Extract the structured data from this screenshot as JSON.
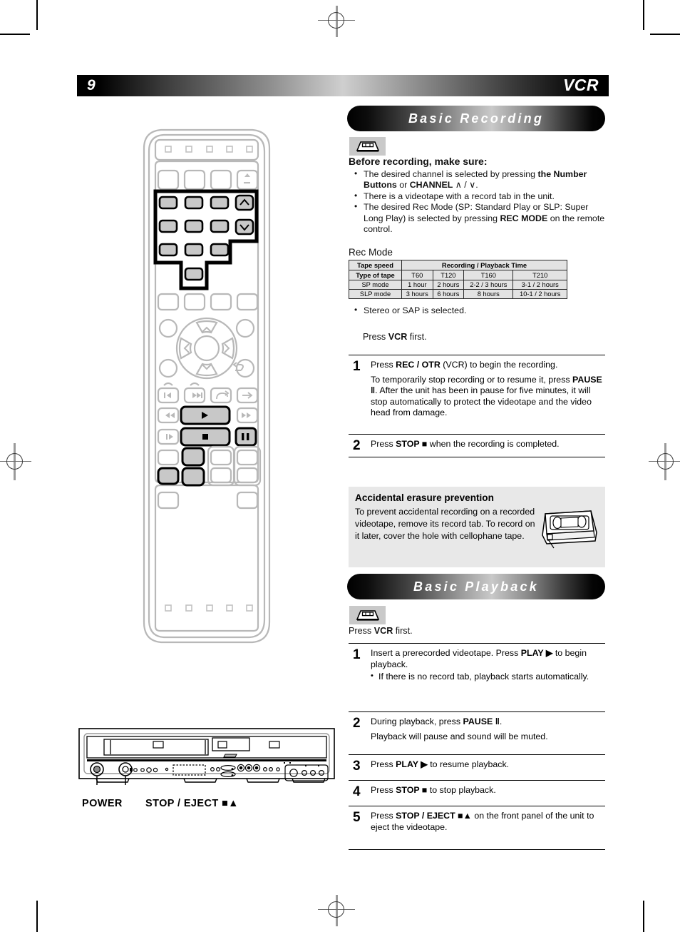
{
  "page": {
    "number": "9",
    "title": "VCR"
  },
  "sections": {
    "recording": {
      "banner": "Basic Recording",
      "tape_icon": "vhs-cassette-icon"
    },
    "playback": {
      "banner": "Basic Playback",
      "tape_icon": "vhs-cassette-icon"
    }
  },
  "before": {
    "heading": "Before recording, make sure:",
    "items": [
      {
        "parts": [
          {
            "t": "The desired channel is selected by pressing ",
            "b": false
          },
          {
            "t": "the Number Buttons",
            "b": true
          },
          {
            "t": " or ",
            "b": false
          },
          {
            "t": "CHANNEL",
            "b": true
          },
          {
            "t": " ∧ / ∨.",
            "b": false
          }
        ]
      },
      {
        "parts": [
          {
            "t": "There is a videotape with a record tab in the unit.",
            "b": false
          }
        ]
      },
      {
        "parts": [
          {
            "t": "The desired Rec Mode (SP: Standard Play or SLP: Super Long Play) is selected by pressing ",
            "b": false
          },
          {
            "t": "REC MODE",
            "b": true
          },
          {
            "t": " on the remote control.",
            "b": false
          }
        ]
      }
    ]
  },
  "rec_mode": {
    "label": "Rec Mode",
    "table": {
      "header_left": "Tape speed",
      "header_span": "Recording / Playback Time",
      "row_type_label": "Type of tape",
      "tape_types": [
        "T60",
        "T120",
        "T160",
        "T210"
      ],
      "rows": [
        {
          "mode": "SP mode",
          "values": [
            "1 hour",
            "2 hours",
            "2-2 / 3 hours",
            "3-1 / 2 hours"
          ]
        },
        {
          "mode": "SLP mode",
          "values": [
            "3 hours",
            "6 hours",
            "8 hours",
            "10-1 / 2 hours"
          ]
        }
      ]
    },
    "stereo_note": "Stereo or SAP is selected."
  },
  "press_vcr_recording": {
    "parts": [
      {
        "t": "Press ",
        "b": false
      },
      {
        "t": "VCR",
        "b": true
      },
      {
        "t": " first.",
        "b": false
      }
    ]
  },
  "press_vcr_playback": {
    "parts": [
      {
        "t": "Press ",
        "b": false
      },
      {
        "t": "VCR",
        "b": true
      },
      {
        "t": " first.",
        "b": false
      }
    ]
  },
  "recording_steps": [
    {
      "num": "1",
      "paras": [
        {
          "parts": [
            {
              "t": "Press ",
              "b": false
            },
            {
              "t": "REC / OTR",
              "b": true
            },
            {
              "t": " (VCR) to begin the recording.",
              "b": false
            }
          ]
        },
        {
          "parts": [
            {
              "t": "To temporarily stop recording or to resume it, press ",
              "b": false
            },
            {
              "t": "PAUSE ‖",
              "b": true
            },
            {
              "t": ". After the unit has been in pause for five minutes, it will stop automatically to protect the videotape and the video head from damage.",
              "b": false
            }
          ]
        }
      ]
    },
    {
      "num": "2",
      "paras": [
        {
          "parts": [
            {
              "t": "Press ",
              "b": false
            },
            {
              "t": "STOP ■",
              "b": true
            },
            {
              "t": " when the recording is completed.",
              "b": false
            }
          ]
        }
      ]
    }
  ],
  "erasure": {
    "title": "Accidental erasure prevention",
    "text": "To prevent accidental recording on a recorded videotape, remove its record tab. To record on it later, cover the hole with cellophane tape.",
    "illustration": "vhs-tape-record-tab-illustration"
  },
  "playback_steps": [
    {
      "num": "1",
      "paras": [
        {
          "parts": [
            {
              "t": "Insert a prerecorded videotape.  Press ",
              "b": false
            },
            {
              "t": "PLAY ▶",
              "b": true
            },
            {
              "t": " to begin playback.",
              "b": false
            }
          ]
        }
      ],
      "sub": "If there is no record tab, playback starts automatically."
    },
    {
      "num": "2",
      "paras": [
        {
          "parts": [
            {
              "t": "During playback, press ",
              "b": false
            },
            {
              "t": "PAUSE ‖",
              "b": true
            },
            {
              "t": ".",
              "b": false
            }
          ]
        },
        {
          "parts": [
            {
              "t": "Playback will pause and sound will be muted.",
              "b": false
            }
          ]
        }
      ]
    },
    {
      "num": "3",
      "paras": [
        {
          "parts": [
            {
              "t": "Press ",
              "b": false
            },
            {
              "t": "PLAY ▶",
              "b": true
            },
            {
              "t": " to resume playback.",
              "b": false
            }
          ]
        }
      ]
    },
    {
      "num": "4",
      "paras": [
        {
          "parts": [
            {
              "t": "Press ",
              "b": false
            },
            {
              "t": "STOP ■",
              "b": true
            },
            {
              "t": " to stop playback.",
              "b": false
            }
          ]
        }
      ]
    },
    {
      "num": "5",
      "paras": [
        {
          "parts": [
            {
              "t": "Press ",
              "b": false
            },
            {
              "t": "STOP / EJECT ■▲",
              "b": true
            },
            {
              "t": " on the front panel of the unit to eject the videotape.",
              "b": false
            }
          ]
        }
      ]
    }
  ],
  "front_panel": {
    "labels": {
      "power": "POWER",
      "stop_eject": "STOP / EJECT ■▲"
    }
  },
  "colors": {
    "banner_dark": "#000000",
    "banner_light": "#c9c9c9",
    "table_bg": "#e3e3e3",
    "callout_bg": "#e8e8e8",
    "badge_bg": "#c9c9c9",
    "remote_outline": "#b4b4b4",
    "remote_highlight": "#000000",
    "remote_key_fill": "#c8c8c8"
  }
}
